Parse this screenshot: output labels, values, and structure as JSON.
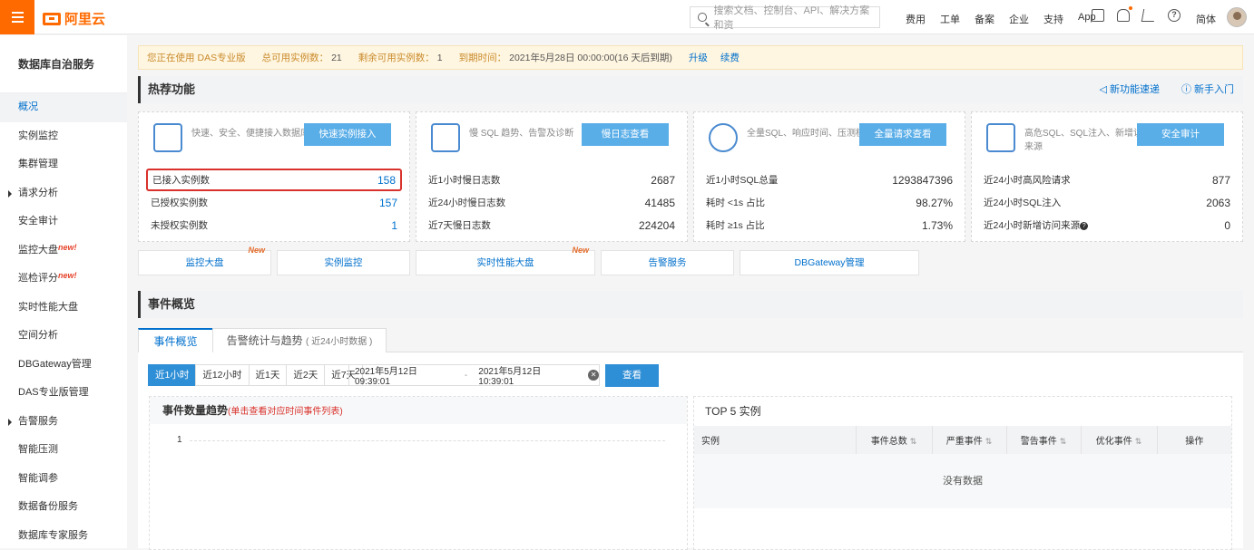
{
  "topbar": {
    "brand": "阿里云",
    "search_placeholder": "搜索文档、控制台、API、解决方案和资",
    "links": [
      "费用",
      "工单",
      "备案",
      "企业",
      "支持",
      "App"
    ],
    "lang": "简体"
  },
  "sidebar": {
    "title": "数据库自治服务",
    "items": [
      {
        "label": "概况",
        "active": true
      },
      {
        "label": "实例监控"
      },
      {
        "label": "集群管理"
      },
      {
        "label": "请求分析",
        "caret": true
      },
      {
        "label": "安全审计"
      },
      {
        "label": "监控大盘",
        "badge": "new!"
      },
      {
        "label": "巡检评分",
        "badge": "new!"
      },
      {
        "label": "实时性能大盘"
      },
      {
        "label": "空间分析"
      },
      {
        "label": "DBGateway管理"
      },
      {
        "label": "DAS专业版管理"
      },
      {
        "label": "告警服务",
        "caret": true
      },
      {
        "label": "智能压测"
      },
      {
        "label": "智能调参"
      },
      {
        "label": "数据备份服务"
      },
      {
        "label": "数据库专家服务"
      }
    ]
  },
  "notice": {
    "using_label": "您正在使用",
    "using_value": "DAS专业版",
    "total_label": "总可用实例数：",
    "total_value": "21",
    "remain_label": "剩余可用实例数：",
    "remain_value": "1",
    "expire_label": "到期时间：",
    "expire_value": "2021年5月28日 00:00:00(16 天后到期)",
    "upgrade": "升级",
    "renew": "续费"
  },
  "hot": {
    "title": "热荐功能",
    "link1": "新功能速递",
    "link2": "新手入门",
    "cards": [
      {
        "desc": "快速、安全、便捷接入数据库",
        "button": "快速实例接入",
        "rows": [
          {
            "label": "已接入实例数",
            "value": "158"
          },
          {
            "label": "已授权实例数",
            "value": "157"
          },
          {
            "label": "未授权实例数",
            "value": "1"
          }
        ]
      },
      {
        "desc": "慢 SQL 趋势、告警及诊断",
        "button": "慢日志查看",
        "rows": [
          {
            "label": "近1小时慢日志数",
            "value": "2687"
          },
          {
            "label": "近24小时慢日志数",
            "value": "41485"
          },
          {
            "label": "近7天慢日志数",
            "value": "224204"
          }
        ]
      },
      {
        "desc": "全量SQL、响应时间、压测模板",
        "button": "全量请求查看",
        "rows": [
          {
            "label": "近1小时SQL总量",
            "value": "1293847396"
          },
          {
            "label": "耗时 <1s 占比",
            "value": "98.27%"
          },
          {
            "label": "耗时 ≥1s 占比",
            "value": "1.73%"
          }
        ]
      },
      {
        "desc": "高危SQL、SQL注入、新增访问来源",
        "button": "安全审计",
        "rows": [
          {
            "label": "近24小时高风险请求",
            "value": "877"
          },
          {
            "label": "近24小时SQL注入",
            "value": "2063"
          },
          {
            "label": "近24小时新增访问来源",
            "value": "0"
          }
        ]
      }
    ],
    "quick": [
      {
        "label": "监控大盘",
        "new": "New"
      },
      {
        "label": "实例监控"
      },
      {
        "label": "实时性能大盘",
        "new": "New"
      },
      {
        "label": "告警服务"
      },
      {
        "label": "DBGateway管理"
      }
    ]
  },
  "events": {
    "title": "事件概览",
    "tab1": "事件概览",
    "tab2": "告警统计与趋势",
    "tab2_sub": "( 近24小时数据 )",
    "ranges": [
      "近1小时",
      "近12小时",
      "近1天",
      "近2天",
      "近7天"
    ],
    "date_start": "2021年5月12日 09:39:01",
    "date_sep": "-",
    "date_end": "2021年5月12日 10:39:01",
    "view_button": "查看",
    "trend_title": "事件数量趋势",
    "trend_tip": "(单击查看对应时间事件列表)",
    "trend_y": "1",
    "top5_title": "TOP 5 实例",
    "columns": [
      "实例",
      "事件总数",
      "严重事件",
      "警告事件",
      "优化事件",
      "操作"
    ],
    "empty": "没有数据"
  },
  "colors": {
    "accent": "#ff6a00",
    "link": "#0070cc",
    "button": "#5aaee8",
    "highlight": "#d9312b"
  }
}
